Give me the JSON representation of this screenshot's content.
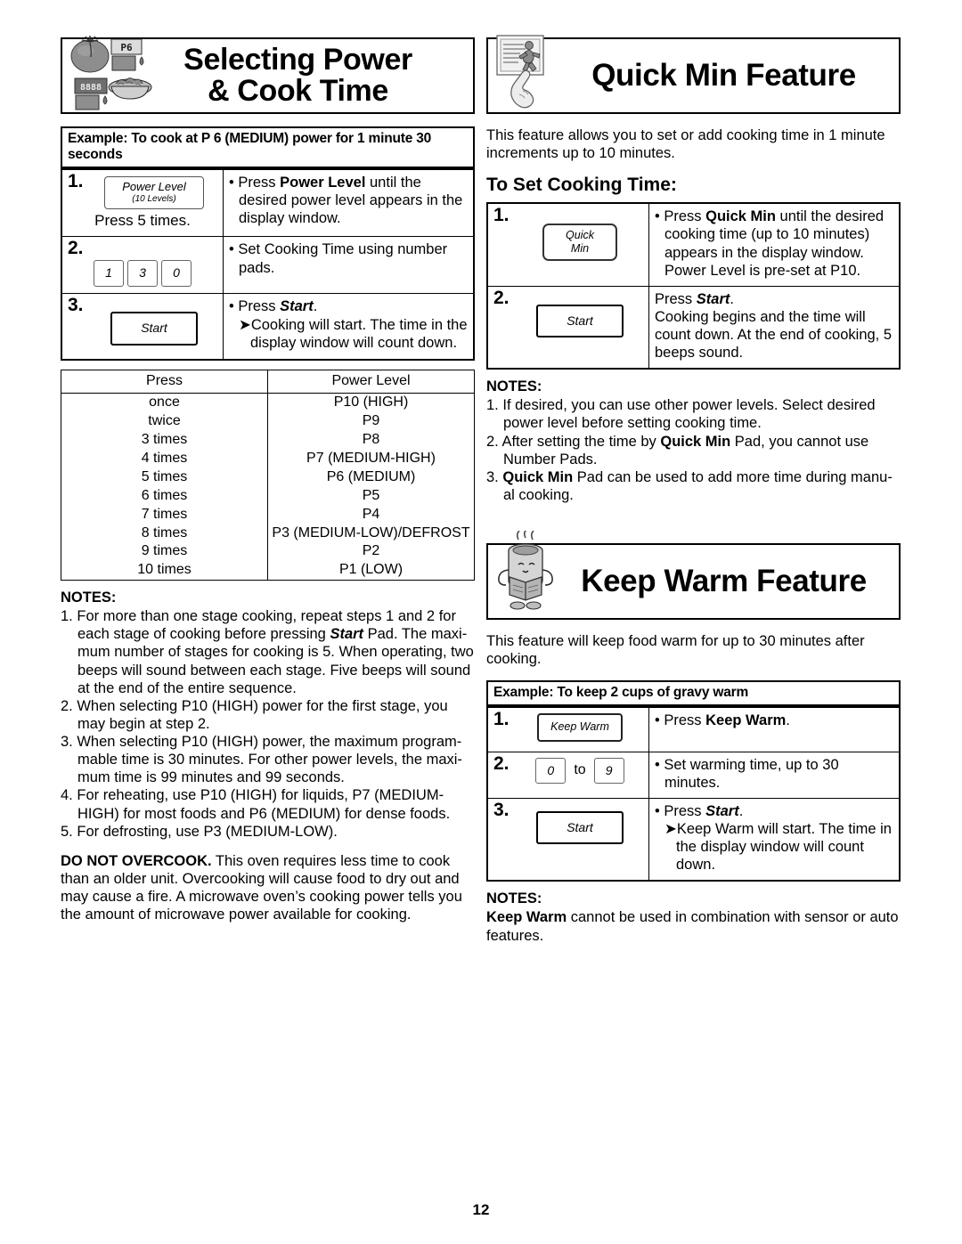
{
  "page": {
    "number": "12"
  },
  "left_column": {
    "banner": {
      "title": "Selecting Power\n& Cook Time",
      "icon": "tomato-display-food-icon"
    },
    "example_bar": "Example: To cook at P 6 (MEDIUM) power for 1 minute 30 seconds",
    "steps": [
      {
        "num": "1.",
        "key_label": "Power Level",
        "key_sub": "(10 Levels)",
        "press_note": "Press 5 times.",
        "lines": [
          {
            "type": "bullet",
            "parts": [
              {
                "t": "• Press ",
                "s": "plain"
              },
              {
                "t": "Power Level",
                "s": "bold"
              },
              {
                "t": " until the desired power level appears in the display window.",
                "s": "plain"
              }
            ]
          }
        ]
      },
      {
        "num": "2.",
        "pads": [
          "1",
          "3",
          "0"
        ],
        "lines": [
          {
            "type": "bullet",
            "parts": [
              {
                "t": "• Set Cooking Time using number pads.",
                "s": "plain"
              }
            ]
          }
        ]
      },
      {
        "num": "3.",
        "key_label": "Start",
        "lines": [
          {
            "type": "bullet",
            "parts": [
              {
                "t": "• Press ",
                "s": "plain"
              },
              {
                "t": "Start",
                "s": "bolditalic"
              },
              {
                "t": ".",
                "s": "plain"
              }
            ]
          },
          {
            "type": "arrow",
            "parts": [
              {
                "t": "➤Cooking will start. The time in the display window will count down.",
                "s": "plain"
              }
            ]
          }
        ]
      }
    ],
    "power_table": {
      "headers": [
        "Press",
        "Power Level"
      ],
      "rows": [
        [
          "once",
          "P10 (HIGH)"
        ],
        [
          "twice",
          "P9"
        ],
        [
          "3 times",
          "P8"
        ],
        [
          "4 times",
          "P7 (MEDIUM-HIGH)"
        ],
        [
          "5 times",
          "P6 (MEDIUM)"
        ],
        [
          "6 times",
          "P5"
        ],
        [
          "7 times",
          "P4"
        ],
        [
          "8 times",
          "P3 (MEDIUM-LOW)/DEFROST"
        ],
        [
          "9 times",
          "P2"
        ],
        [
          "10 times",
          "P1 (LOW)"
        ]
      ]
    },
    "notes_head": "NOTES:",
    "notes": [
      {
        "num": "1.",
        "parts": [
          {
            "t": "For more than one stage cooking, repeat steps 1 and 2 for each stage of cooking before pressing ",
            "s": "plain"
          },
          {
            "t": "Start",
            "s": "bolditalic"
          },
          {
            "t": " Pad. The maxi-mum number of stages for cooking is 5. When operating, two beeps will sound between each stage. Five beeps will sound at the end of the entire sequence.",
            "s": "plain"
          }
        ]
      },
      {
        "num": "2.",
        "parts": [
          {
            "t": "When selecting P10 (HIGH) power for the first stage, you may begin at step 2.",
            "s": "plain"
          }
        ]
      },
      {
        "num": "3.",
        "parts": [
          {
            "t": "When selecting P10 (HIGH) power, the maximum program-mable time is 30 minutes. For other power levels, the maxi-mum time is 99 minutes and 99 seconds.",
            "s": "plain"
          }
        ]
      },
      {
        "num": "4.",
        "parts": [
          {
            "t": "For reheating, use P10 (HIGH) for liquids, P7 (MEDIUM-HIGH) for most foods and P6 (MEDIUM) for dense foods.",
            "s": "plain"
          }
        ]
      },
      {
        "num": "5.",
        "parts": [
          {
            "t": "For defrosting, use P3 (MEDIUM-LOW).",
            "s": "plain"
          }
        ]
      }
    ],
    "warning": [
      {
        "t": "DO NOT OVERCOOK.",
        "s": "bold"
      },
      {
        "t": " This oven requires less time to cook than an older unit. Overcooking will cause food to dry out and may cause a fire. A microwave oven’s cooking power tells you the amount of microwave power available for cooking.",
        "s": "plain"
      }
    ]
  },
  "right_column": {
    "quick_min": {
      "banner": {
        "title": "Quick Min Feature",
        "icon": "display-window-hand-icon"
      },
      "intro": "This feature allows you to set or add cooking time in 1 minute increments up to 10 minutes.",
      "subhead": "To Set Cooking Time:",
      "steps": [
        {
          "num": "1.",
          "key_label": "Quick\nMin",
          "lines": [
            {
              "type": "bullet",
              "parts": [
                {
                  "t": "• Press ",
                  "s": "plain"
                },
                {
                  "t": "Quick Min",
                  "s": "bold"
                },
                {
                  "t": " until the desired cooking time (up to 10 minutes) appears in the display window. Power Level is pre-set at P10.",
                  "s": "plain"
                }
              ]
            }
          ]
        },
        {
          "num": "2.",
          "key_label": "Start",
          "lines": [
            {
              "type": "plain",
              "parts": [
                {
                  "t": "Press ",
                  "s": "plain"
                },
                {
                  "t": "Start",
                  "s": "bolditalic"
                },
                {
                  "t": ".",
                  "s": "plain"
                }
              ]
            },
            {
              "type": "plain",
              "parts": [
                {
                  "t": "Cooking begins and the time will count down. At the end of cooking, 5 beeps sound.",
                  "s": "plain"
                }
              ]
            }
          ]
        }
      ],
      "notes_head": "NOTES:",
      "notes": [
        {
          "num": "1.",
          "parts": [
            {
              "t": "If desired, you can use other power levels. Select desired power level before setting cooking time.",
              "s": "plain"
            }
          ]
        },
        {
          "num": "2.",
          "parts": [
            {
              "t": "After setting the time by ",
              "s": "plain"
            },
            {
              "t": "Quick Min",
              "s": "bold"
            },
            {
              "t": " Pad, you cannot use Number Pads.",
              "s": "plain"
            }
          ]
        },
        {
          "num": "3.",
          "parts": [
            {
              "t": "Quick Min",
              "s": "bold"
            },
            {
              "t": " Pad can be used to add more time during manu-al cooking.",
              "s": "plain"
            }
          ]
        }
      ]
    },
    "keep_warm": {
      "banner": {
        "title": "Keep Warm Feature",
        "icon": "steaming-cup-reading-icon"
      },
      "intro": "This feature will keep food warm for up to 30 minutes after cooking.",
      "example_bar": "Example: To keep 2 cups of gravy warm",
      "steps": [
        {
          "num": "1.",
          "key_label": "Keep Warm",
          "lines": [
            {
              "type": "bullet",
              "parts": [
                {
                  "t": "• Press ",
                  "s": "plain"
                },
                {
                  "t": "Keep Warm",
                  "s": "bold"
                },
                {
                  "t": ".",
                  "s": "plain"
                }
              ]
            }
          ]
        },
        {
          "num": "2.",
          "pads_range": {
            "from": "0",
            "to_word": "to",
            "to": "9"
          },
          "lines": [
            {
              "type": "bullet",
              "parts": [
                {
                  "t": "• Set warming time, up to 30 minutes.",
                  "s": "plain"
                }
              ]
            }
          ]
        },
        {
          "num": "3.",
          "key_label": "Start",
          "lines": [
            {
              "type": "bullet",
              "parts": [
                {
                  "t": "• Press ",
                  "s": "plain"
                },
                {
                  "t": "Start",
                  "s": "bolditalic"
                },
                {
                  "t": ".",
                  "s": "plain"
                }
              ]
            },
            {
              "type": "arrow",
              "parts": [
                {
                  "t": "➤Keep Warm will start. The time in the display window will count down.",
                  "s": "plain"
                }
              ]
            }
          ]
        }
      ],
      "notes_head": "NOTES:",
      "notes_plain": [
        {
          "t": "Keep Warm",
          "s": "bold"
        },
        {
          "t": " cannot be used in combination with sensor or auto features.",
          "s": "plain"
        }
      ]
    }
  },
  "colors": {
    "ink": "#000000",
    "paper": "#ffffff",
    "icon_gray": "#9a9a9a"
  }
}
